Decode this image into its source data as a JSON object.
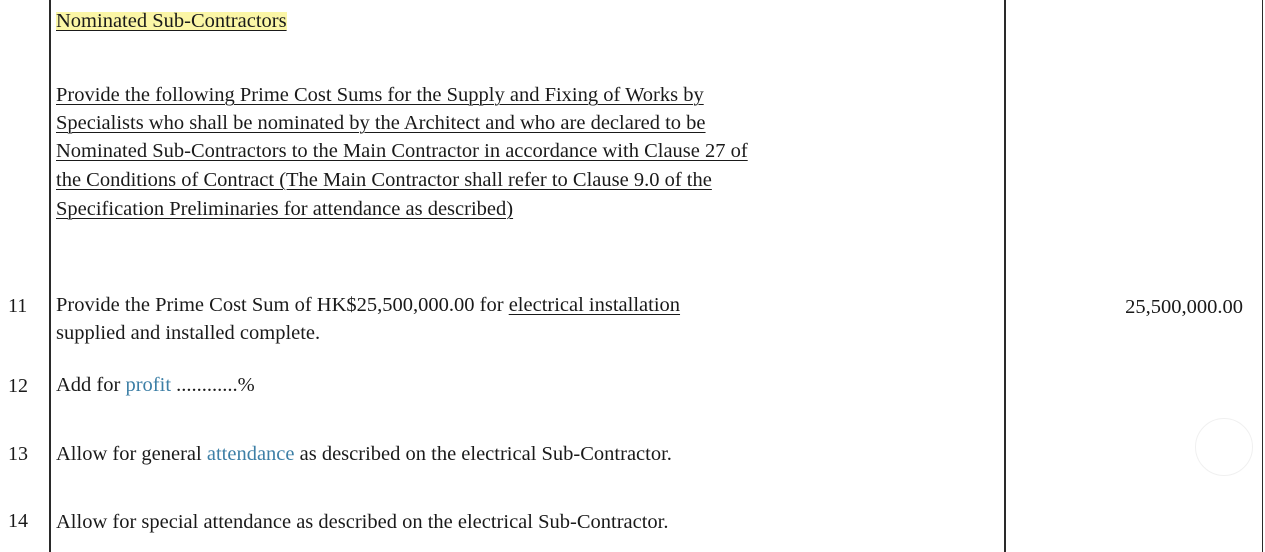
{
  "section": {
    "heading": "Nominated Sub-Contractors",
    "intro_lines": [
      "Provide  the following Prime Cost Sums for the Supply and Fixing of Works by",
      "Specialists who shall be nominated by the Architect and who are declared to be",
      "Nominated Sub-Contractors to the Main Contractor in accordance with Clause 27 of",
      "the Conditions of Contract (The Main Contractor shall refer to Clause 9.0 of the",
      "Specification Preliminaries for attendance as described)"
    ]
  },
  "items": [
    {
      "number": "11",
      "line1_pre": "Provide the Prime Cost Sum of HK$25,500,000.00 for ",
      "line1_underlined": "electrical installation",
      "line2": "supplied and installed complete.",
      "amount": "25,500,000.00"
    },
    {
      "number": "12",
      "pre": "Add for ",
      "highlight": "profit",
      "post": " ............%"
    },
    {
      "number": "13",
      "pre": "Allow for general ",
      "highlight": "attendance",
      "post": " as described on the electrical Sub-Contractor."
    },
    {
      "number": "14",
      "text": "Allow for special attendance as described on the electrical Sub-Contractor."
    }
  ]
}
